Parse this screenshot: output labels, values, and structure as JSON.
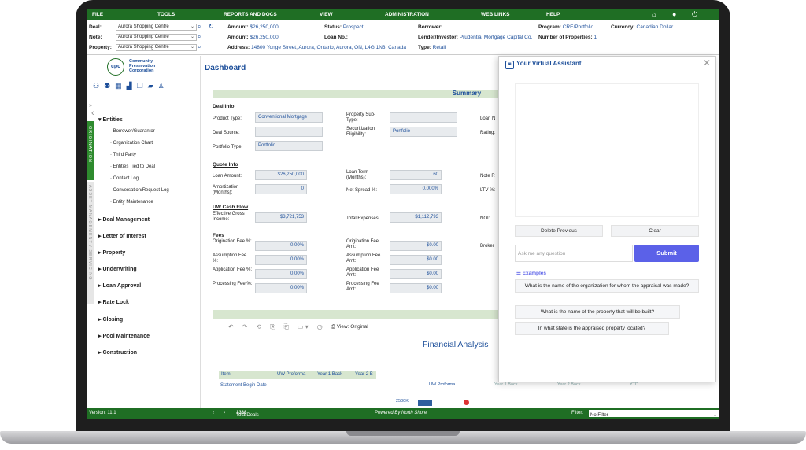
{
  "nav": {
    "items": [
      "FILE",
      "TOOLS",
      "REPORTS AND DOCS",
      "VIEW",
      "ADMINISTRATION",
      "WEB LINKS",
      "HELP"
    ],
    "icons": [
      "home-icon",
      "user-icon",
      "power-icon"
    ]
  },
  "header": {
    "deal_label": "Deal:",
    "deal_value": "Aurora Shopping Centre",
    "note_label": "Note:",
    "note_value": "Aurora Shopping Centre",
    "property_label": "Property:",
    "property_value": "Aurora Shopping Centre",
    "amount1_label": "Amount:",
    "amount1_value": "$26,250,000",
    "amount2_label": "Amount:",
    "amount2_value": "$26,250,000",
    "address_label": "Address:",
    "address_value": "14800 Yonge Street, Aurora, Ontario, Aurora, ON, L4G 1N3, Canada",
    "status_label": "Status:",
    "status_value": "Prospect",
    "loanno_label": "Loan No.:",
    "loanno_value": "",
    "type_label": "Type:",
    "type_value": "Retail",
    "borrower_label": "Borrower:",
    "borrower_value": "",
    "lender_label": "Lender/Investor:",
    "lender_value": "Prudential Mortgage Capital Co.",
    "program_label": "Program:",
    "program_value": "CRE/Portfolio",
    "numprops_label": "Number of Properties:",
    "numprops_value": "1",
    "currency_label": "Currency:",
    "currency_value": "Canadian Dollar"
  },
  "sidebar": {
    "logo_text": "cpc",
    "org_line1": "Community",
    "org_line2": "Preservation",
    "org_line3": "Corporation",
    "vtab_origination": "ORIGINATION",
    "vtab_asset": "ASSET MANAGEMENT / SERVICING",
    "entities": "Entities",
    "sub_items": [
      "Borrower/Guarantor",
      "Organization Chart",
      "Third Party",
      "Entities Tied to Deal",
      "Contact Log",
      "Conversation/Request Log",
      "Entity Maintenance"
    ],
    "groups": [
      "Deal Management",
      "Letter of Interest",
      "Property",
      "Underwriting",
      "Loan Approval",
      "Rate Lock",
      "Closing",
      "Pool Maintenance",
      "Construction"
    ]
  },
  "main": {
    "title": "Dashboard",
    "summary": "Summary",
    "deal_info": "Deal Info",
    "product_type_label": "Product Type:",
    "product_type": "Conventional Mortgage",
    "deal_source_label": "Deal Source:",
    "deal_source": "",
    "portfolio_type_label": "Portfolio Type:",
    "portfolio_type": "Portfolio",
    "prop_subtype_label": "Property Sub-Type:",
    "prop_subtype": "",
    "securitization_label": "Securitization Eligibility:",
    "securitization": "Portfolio",
    "loan_n_label": "Loan N",
    "rating_label": "Rating:",
    "quote_info": "Quote Info",
    "loan_amount_label": "Loan Amount:",
    "loan_amount": "$26,250,000",
    "amortization_label": "Amortization (Months):",
    "amortization": "0",
    "loan_term_label": "Loan Term (Months):",
    "loan_term": "60",
    "net_spread_label": "Net Spread %:",
    "net_spread": "0.000%",
    "note_r_label": "Note R",
    "ltv_label": "LTV %:",
    "uw_cash_flow": "UW Cash Flow",
    "egi_label": "Effective Gross Income:",
    "egi": "$3,721,753",
    "total_exp_label": "Total Expenses:",
    "total_exp": "$1,112,793",
    "noi_label": "NOI:",
    "fees": "Fees",
    "orig_fee_pct_label": "Origination Fee %:",
    "orig_fee_pct": "0.00%",
    "assump_fee_pct_label": "Assumption Fee %:",
    "assump_fee_pct": "0.00%",
    "app_fee_pct_label": "Application Fee %:",
    "app_fee_pct": "0.00%",
    "proc_fee_pct_label": "Processing Fee %:",
    "proc_fee_pct": "0.00%",
    "orig_fee_amt_label": "Origination Fee Amt:",
    "orig_fee_amt": "$0.00",
    "assump_fee_amt_label": "Assumption Fee Amt:",
    "assump_fee_amt": "$0.00",
    "app_fee_amt_label": "Application Fee Amt:",
    "app_fee_amt": "$0.00",
    "proc_fee_amt_label": "Processing Fee Amt:",
    "proc_fee_amt": "$0.00",
    "broker_label": "Broker",
    "view_label": "View: Original",
    "financial_analysis": "Financial Analysis",
    "table_item": "Item",
    "table_uw": "UW Proforma",
    "table_y1": "Year 1 Back",
    "table_y2": "Year 2 B",
    "row1": "Statement Begin Date",
    "chart_uw": "UW Proforma",
    "chart_y1": "Year 1 Back",
    "chart_y2": "Year 2 Back",
    "chart_ytd": "YTD",
    "chart_2500k": "2500K"
  },
  "assistant": {
    "title": "Your Virtual Assistant",
    "delete_previous": "Delete Previous",
    "clear": "Clear",
    "placeholder": "Ask me any question",
    "submit": "Submit",
    "examples_label": "Examples",
    "examples": [
      "What is the name of the organization for whom the appraisal was made?",
      "What is the name of the property that will be built?",
      "In what state is the appraised property located?"
    ]
  },
  "status": {
    "version": "Version: 11.1",
    "total_prefix": "Total",
    "total_count": "1338",
    "total_suffix": "Deals",
    "powered": "Powered By North Shore",
    "filter_label": "Filter:",
    "filter_value": "No Filter"
  }
}
